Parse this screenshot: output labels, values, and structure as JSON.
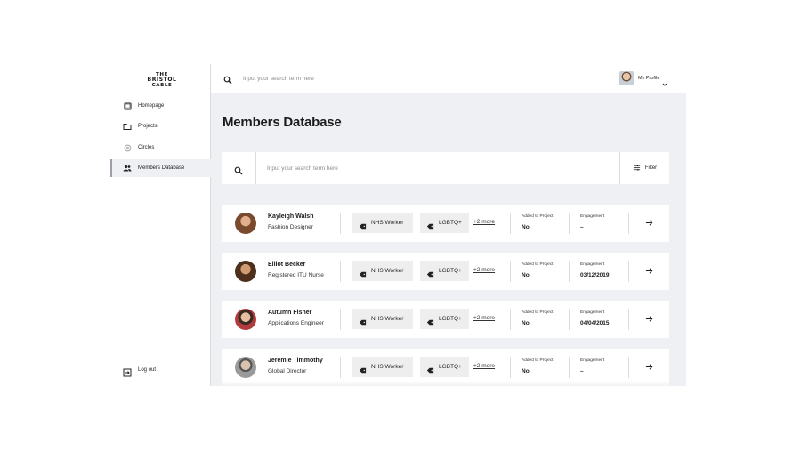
{
  "brand": {
    "line1": "THE",
    "line2": "BRISTOL",
    "line3": "CABLE"
  },
  "sidebar": {
    "items": [
      {
        "label": "Homepage",
        "icon": "tablet-icon"
      },
      {
        "label": "Projects",
        "icon": "folder-icon"
      },
      {
        "label": "Circles",
        "icon": "circle-icon"
      },
      {
        "label": "Members Database",
        "icon": "people-icon",
        "active": true
      }
    ],
    "logout": {
      "label": "Log out",
      "icon": "logout-icon"
    }
  },
  "topbar": {
    "search_placeholder": "Input your search term here",
    "profile_label": "My Profile"
  },
  "page": {
    "title": "Members Database"
  },
  "filterbar": {
    "search_placeholder": "Input your search term here",
    "filter_label": "Filter"
  },
  "members": [
    {
      "name": "Kayleigh Walsh",
      "role": "Fashion Designer",
      "tags": [
        "NHS Worker",
        "LGBTQ+"
      ],
      "more": "+2 more",
      "added_label": "Added to Project",
      "added": "No",
      "engagement_label": "Engagement",
      "engagement": "–",
      "avatar_color": "#8a5a3c"
    },
    {
      "name": "Elliot Becker",
      "role": "Registered ITU Nurse",
      "tags": [
        "NHS Worker",
        "LGBTQ+"
      ],
      "more": "+2 more",
      "added_label": "Added to Project",
      "added": "No",
      "engagement_label": "Engagement",
      "engagement": "03/12/2019",
      "avatar_color": "#5c3a24"
    },
    {
      "name": "Autumn Fisher",
      "role": "Applications Engineer",
      "tags": [
        "NHS Worker",
        "LGBTQ+"
      ],
      "more": "+2 more",
      "added_label": "Added to Project",
      "added": "No",
      "engagement_label": "Engagement",
      "engagement": "04/04/2015",
      "avatar_color": "#b23b3b"
    },
    {
      "name": "Jeremie Timmothy",
      "role": "Global Director",
      "tags": [
        "NHS Worker",
        "LGBTQ+"
      ],
      "more": "+2 more",
      "added_label": "Added to Project",
      "added": "No",
      "engagement_label": "Engagement",
      "engagement": "–",
      "avatar_color": "#6d6d6d"
    }
  ]
}
